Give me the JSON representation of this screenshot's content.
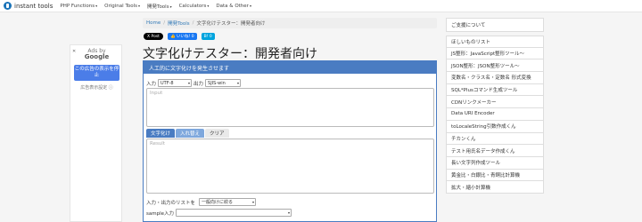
{
  "navbar": {
    "brand": "instant tools",
    "items": [
      {
        "label": "PHP Functions",
        "caret": "▾"
      },
      {
        "label": "Original Tools",
        "caret": "▾"
      },
      {
        "label": "開発Tools",
        "caret": "▾"
      },
      {
        "label": "Calculators",
        "caret": "▾"
      },
      {
        "label": "Data & Other",
        "caret": "▾"
      }
    ]
  },
  "ad": {
    "close": "✕",
    "ads_by": "Ads by",
    "google": "Google",
    "stop_button": "この広告の表示を停止",
    "settings": "広告表示設定 ⓘ"
  },
  "breadcrumb": {
    "home": "Home",
    "section": "開発Tools",
    "current": "文字化けテスター：開発者向け",
    "sep": "/"
  },
  "share": {
    "x": "X Post",
    "fb": "👍 いいね! 0",
    "hatena": "B! 0"
  },
  "page_title": "文字化けテスター：開発者向け",
  "panel": {
    "header": "人工的に文字化けを発生させます",
    "input_label": "入力",
    "input_encoding": "UTF-8",
    "output_label": "出力",
    "output_encoding": "SJIS-win",
    "input_placeholder": "Input",
    "tabs": [
      "文字化け",
      "入れ替え",
      "クリア"
    ],
    "result_placeholder": "Result",
    "list_label": "入力・出力のリストを",
    "list_select": "一般向けに絞る",
    "sample_label": "sample入力",
    "sample_select": ""
  },
  "sidebar": {
    "top_item": "ご支援について",
    "items": [
      "ほしいものリスト",
      "JS整形：JavaScript整形ツール～",
      "JSON整形：JSON整形ツール～",
      "変数名・クラス名・定数名 形式変換",
      "SQL*Plusコマンド生成ツール",
      "CDNリンクメーカー",
      "Data URI Encoder",
      "toLocaleString引数作成くん",
      "チカンくん",
      "テスト用氏名データ作成くん",
      "長い文字列作成ツール",
      "黄金比・白銀比・青銅比計算機",
      "拡大・縮小計算機"
    ]
  }
}
